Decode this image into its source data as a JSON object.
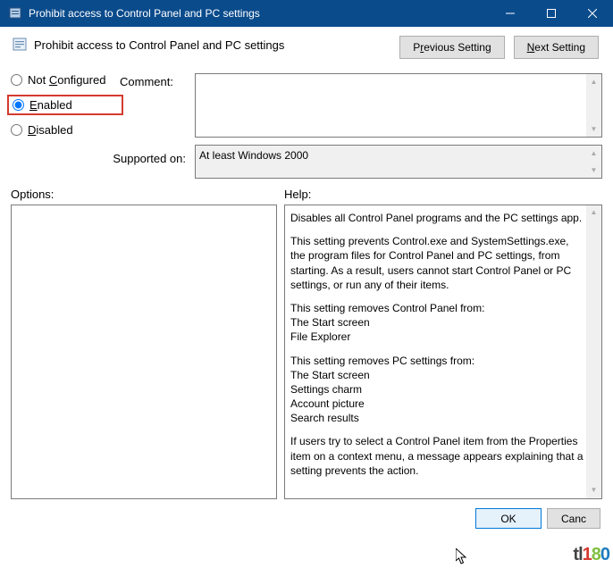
{
  "title": "Prohibit access to Control Panel and PC settings",
  "heading": "Prohibit access to Control Panel and PC settings",
  "nav": {
    "prev_pre": "P",
    "prev_u": "r",
    "prev_post": "evious Setting",
    "next_pre": "",
    "next_u": "N",
    "next_post": "ext Setting"
  },
  "radios": {
    "not_pre": "Not ",
    "not_u": "C",
    "not_post": "onfigured",
    "en_u": "E",
    "en_post": "nabled",
    "dis_u": "D",
    "dis_post": "isabled"
  },
  "labels": {
    "comment": "Comment:",
    "supported": "Supported on:",
    "options": "Options:",
    "help": "Help:"
  },
  "supported_text": "At least Windows 2000",
  "help": {
    "p1": "Disables all Control Panel programs and the PC settings app.",
    "p2": "This setting prevents Control.exe and SystemSettings.exe, the program files for Control Panel and PC settings, from starting. As a result, users cannot start Control Panel or PC settings, or run any of their items.",
    "p3a": "This setting removes Control Panel from:",
    "p3b": "The Start screen",
    "p3c": "File Explorer",
    "p4a": "This setting removes PC settings from:",
    "p4b": "The Start screen",
    "p4c": "Settings charm",
    "p4d": "Account picture",
    "p4e": "Search results",
    "p5": "If users try to select a Control Panel item from the Properties item on a context menu, a message appears explaining that a setting prevents the action."
  },
  "buttons": {
    "ok": "OK",
    "cancel": "Canc"
  },
  "watermark": {
    "a": "t",
    "b": "l",
    "c": "1",
    "d": "8",
    "e": "0"
  }
}
